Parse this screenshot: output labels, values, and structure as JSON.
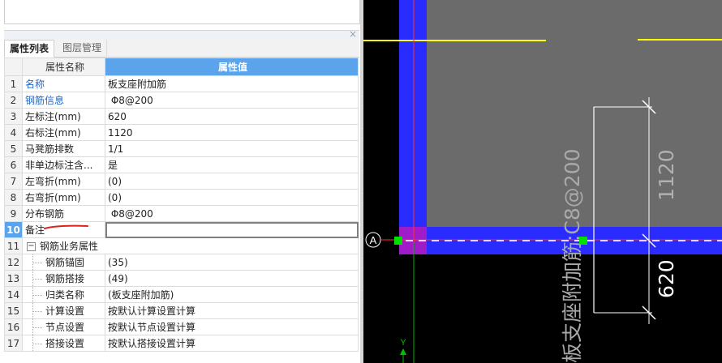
{
  "tabs": {
    "properties_label": "属性列表",
    "layers_label": "图层管理"
  },
  "table": {
    "col_name_header": "属性名称",
    "col_value_header": "属性值",
    "rows": [
      {
        "num": "1",
        "name": "名称",
        "value": "板支座附加筋"
      },
      {
        "num": "2",
        "name": "钢筋信息",
        "value": " Φ8@200"
      },
      {
        "num": "3",
        "name": "左标注(mm)",
        "value": "620"
      },
      {
        "num": "4",
        "name": "右标注(mm)",
        "value": "1120"
      },
      {
        "num": "5",
        "name": "马凳筋排数",
        "value": "1/1"
      },
      {
        "num": "6",
        "name": "非单边标注含...",
        "value": "是"
      },
      {
        "num": "7",
        "name": "左弯折(mm)",
        "value": "(0)"
      },
      {
        "num": "8",
        "name": "右弯折(mm)",
        "value": "(0)"
      },
      {
        "num": "9",
        "name": "分布钢筋",
        "value": " Φ8@200"
      },
      {
        "num": "10",
        "name": "备注",
        "value": ""
      },
      {
        "num": "11",
        "name": "钢筋业务属性",
        "value": ""
      },
      {
        "num": "12",
        "name": "钢筋锚固",
        "value": "(35)"
      },
      {
        "num": "13",
        "name": "钢筋搭接",
        "value": "(49)"
      },
      {
        "num": "14",
        "name": "归类名称",
        "value": "(板支座附加筋)"
      },
      {
        "num": "15",
        "name": "计算设置",
        "value": "按默认计算设置计算"
      },
      {
        "num": "16",
        "name": "节点设置",
        "value": "按默认节点设置计算"
      },
      {
        "num": "17",
        "name": "搭接设置",
        "value": "按默认搭接设置计算"
      }
    ],
    "group_expander": "−"
  },
  "panel": {
    "close_glyph": "×"
  },
  "canvas": {
    "axis_label_a": "A",
    "axis_label_y": "Y",
    "rebar_label": "板支座附加筋:C8@200",
    "dim_right": "1120",
    "dim_left": "620",
    "colors": {
      "background": "#000000",
      "slab_fill": "#6b6b6b",
      "beam_blue": "#2a2bff",
      "beam_magenta": "#a01cc8",
      "axis_yellow": "#ffff00",
      "axis_red": "#ff3030",
      "axis_green": "#00b000",
      "rebar_dashed": "#f0d0e0",
      "dim_line": "#ffffff",
      "annot_red": "#e02020"
    }
  }
}
